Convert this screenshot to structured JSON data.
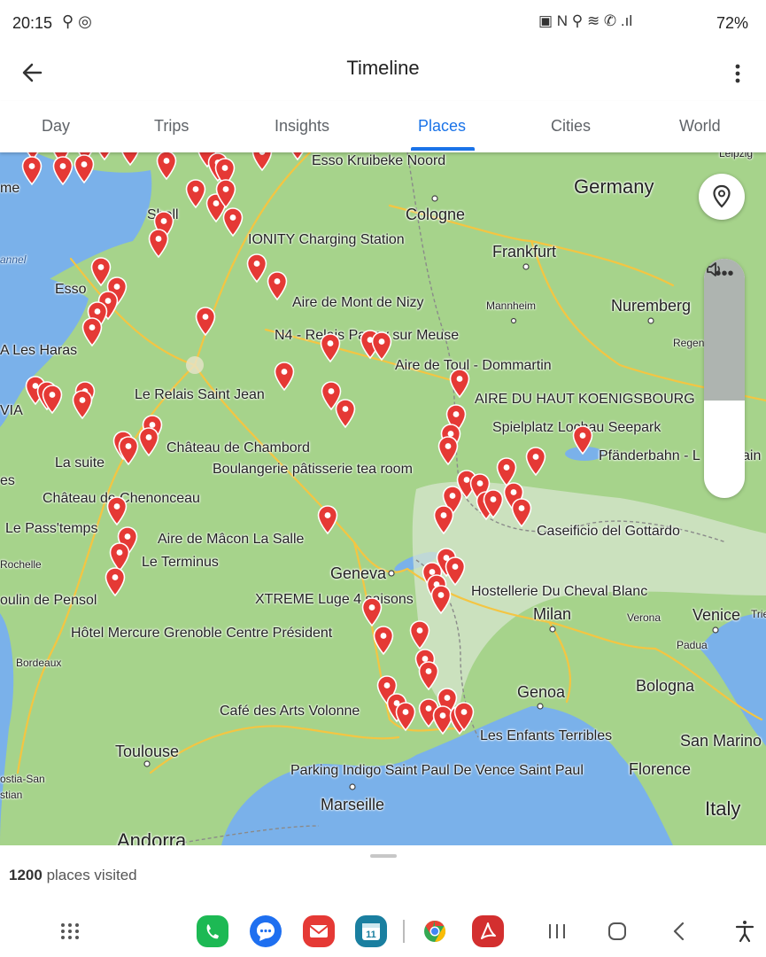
{
  "status": {
    "time": "20:15",
    "left_icons": "⚲ ◎",
    "right_icons": "▣ N ⚲ ≋ ✆ .ıl",
    "battery": "72%"
  },
  "appbar": {
    "title": "Timeline"
  },
  "tabs": [
    {
      "label": "Day"
    },
    {
      "label": "Trips"
    },
    {
      "label": "Insights"
    },
    {
      "label": "Places",
      "active": true
    },
    {
      "label": "Cities"
    },
    {
      "label": "World"
    }
  ],
  "map_labels": {
    "esso_kruibeke": "Esso Kruibeke Noord",
    "leipzig": "Leipzig",
    "germany": "Germany",
    "me": "me",
    "shell": "Shell",
    "cologne": "Cologne",
    "ionity": "IONITY Charging Station",
    "frankfurt": "Frankfurt",
    "channel": "annel",
    "esso": "Esso",
    "aire_nizy": "Aire de Mont de Nizy",
    "mannheim": "Mannheim",
    "nuremberg": "Nuremberg",
    "n4": "N4 - Relais Pagny sur Meuse",
    "regensburg": "Regen",
    "les_haras": "A Les Haras",
    "aire_toul": "Aire de Toul - Dommartin",
    "relais_saint_jean": "Le Relais Saint Jean",
    "aire_koenigsbourg": "AIRE DU HAUT KOENIGSBOURG",
    "via": "VIA",
    "spielplatz": "Spielplatz Lochau Seepark",
    "chambord": "Château de Chambord",
    "pfanderbahn": "Pfänderbahn - L",
    "ain": "ain",
    "la_suite": "La suite",
    "boulangerie": "Boulangerie pâtisserie tea room",
    "es": "es",
    "chenonceau": "Château de Chenonceau",
    "pass_temps": "Le Pass'temps",
    "caseificio": "Caseificio del Gottardo",
    "aire_macon": "Aire de Mâcon La Salle",
    "rochelle": "Rochelle",
    "le_terminus": "Le Terminus",
    "geneva": "Geneva",
    "hostellerie": "Hostellerie Du Cheval Blanc",
    "moulin_pensol": "oulin de Pensol",
    "xtreme": "XTREME Luge 4 saisons",
    "milan": "Milan",
    "verona": "Verona",
    "venice": "Venice",
    "trieste": "Trie",
    "hotel_mercure": "Hôtel Mercure Grenoble Centre Président",
    "padua": "Padua",
    "bordeaux": "Bordeaux",
    "genoa": "Genoa",
    "bologna": "Bologna",
    "cafe_volonne": "Café des Arts Volonne",
    "enfants_terribles": "Les Enfants Terribles",
    "san_marino": "San Marino",
    "toulouse": "Toulouse",
    "florence": "Florence",
    "ostia_san": "ostia-San",
    "stian": "stian",
    "parking_indigo": "Parking Indigo Saint Paul De Vence Saint Paul",
    "marseille": "Marseille",
    "italy": "Italy",
    "andorra": "Andorra"
  },
  "sheet": {
    "count": "1200",
    "suffix": "places visited"
  },
  "dock": {
    "apps_icon": "apps-grid-icon",
    "phone_icon": "phone-icon",
    "messages_icon": "messages-icon",
    "email_icon": "email-icon",
    "calendar_icon": "calendar-icon",
    "calendar_day": "11",
    "chrome_icon": "chrome-icon",
    "acrobat_icon": "acrobat-icon",
    "recents_icon": "recents-icon",
    "home_icon": "home-icon",
    "back_icon": "back-icon",
    "accessibility_icon": "accessibility-icon"
  },
  "colors": {
    "accent": "#1a73e8",
    "pin": "#e53935",
    "land": "#a6d38b",
    "water": "#7ab1ea",
    "road": "#f4c542"
  }
}
